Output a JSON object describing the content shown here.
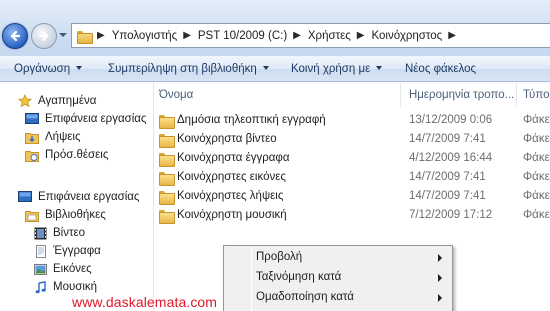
{
  "address_bar": {
    "crumbs": [
      "Υπολογιστής",
      "PST 10/2009 (C:)",
      "Χρήστες",
      "Κοινόχρηστος"
    ]
  },
  "toolbar": {
    "organize": "Οργάνωση",
    "include_library": "Συμπερίληψη στη βιβλιοθήκη",
    "share_with": "Κοινή χρήση με",
    "new_folder": "Νέος φάκελος"
  },
  "sidebar": {
    "favorites": "Αγαπημένα",
    "fav_items": [
      "Επιφάνεια εργασίας",
      "Λήψεις",
      "Πρόσ.θέσεις"
    ],
    "desktop": "Επιφάνεια εργασίας",
    "libraries": "Βιβλιοθήκες",
    "lib_items": [
      "Βίντεο",
      "Έγγραφα",
      "Εικόνες",
      "Μουσική"
    ]
  },
  "columns": {
    "name": "Όνομα",
    "date": "Ημερομηνία τροπο...",
    "type": "Τύπο"
  },
  "files": [
    {
      "name": "Δημόσια τηλεοπτική εγγραφή",
      "date": "13/12/2009 0:06",
      "type": "Φάκε"
    },
    {
      "name": "Κοινόχρηστα βίντεο",
      "date": "14/7/2009 7:41",
      "type": "Φάκε"
    },
    {
      "name": "Κοινόχρηστα έγγραφα",
      "date": "4/12/2009 16:44",
      "type": "Φάκε"
    },
    {
      "name": "Κοινόχρηστες εικόνες",
      "date": "14/7/2009 7:41",
      "type": "Φάκε"
    },
    {
      "name": "Κοινόχρηστες λήψεις",
      "date": "14/7/2009 7:41",
      "type": "Φάκε"
    },
    {
      "name": "Κοινόχρηστη μουσική",
      "date": "7/12/2009 17:12",
      "type": "Φάκε"
    }
  ],
  "context_menu": {
    "items": [
      "Προβολή",
      "Ταξινόμηση κατά",
      "Ομαδοποίηση κατά"
    ]
  },
  "watermark": "www.daskalemata.com",
  "colors": {
    "toolbar_text": "#1e3a64",
    "watermark": "#e0182a",
    "folder": "#e8b647"
  }
}
